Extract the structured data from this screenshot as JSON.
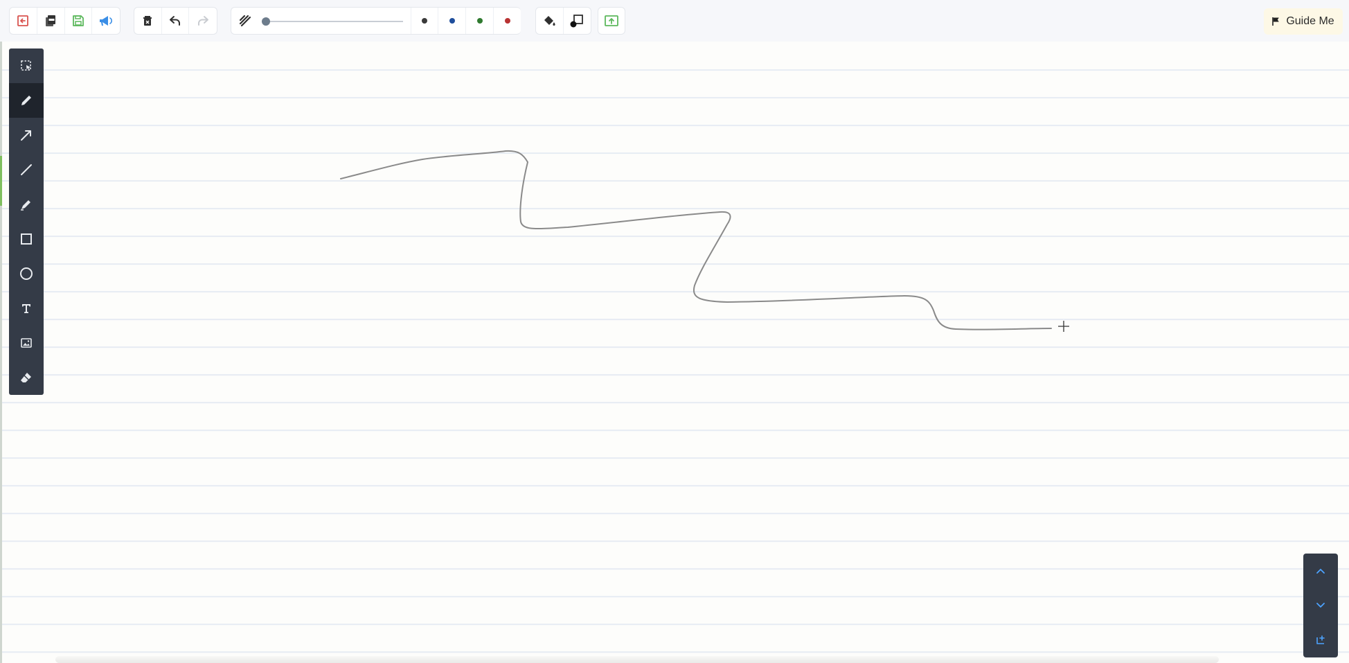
{
  "toolbar": {
    "file_group": [
      {
        "icon": "exit-icon",
        "color": "#d9534f"
      },
      {
        "icon": "pdf-icon",
        "color": "#444444"
      },
      {
        "icon": "save-icon",
        "color": "#5cb85c"
      },
      {
        "icon": "announcement-icon",
        "color": "#3a8ee6"
      }
    ],
    "edit_group": [
      {
        "icon": "clear-page-icon"
      },
      {
        "icon": "undo-icon"
      },
      {
        "icon": "redo-icon",
        "disabled": true
      }
    ],
    "stroke_width": {
      "icon": "stroke-width-icon",
      "value": 0.0
    },
    "pen_colors": [
      "#3a3a3a",
      "#1f4e9c",
      "#2f7a2f",
      "#b83232"
    ],
    "fill_group": [
      {
        "icon": "fill-bucket-icon"
      },
      {
        "icon": "shape-fill-icon"
      }
    ],
    "upload": {
      "icon": "upload-icon",
      "color": "#5cb85c"
    },
    "guide_label": "Guide Me",
    "guide_icon": "flag-icon"
  },
  "tools": [
    {
      "name": "select-tool",
      "icon": "selection-icon",
      "active": false
    },
    {
      "name": "pen-tool",
      "icon": "pen-icon",
      "active": true
    },
    {
      "name": "arrow-tool",
      "icon": "arrow-icon",
      "active": false
    },
    {
      "name": "line-tool",
      "icon": "line-icon",
      "active": false
    },
    {
      "name": "highlighter-tool",
      "icon": "highlighter-icon",
      "active": false
    },
    {
      "name": "rectangle-tool",
      "icon": "rectangle-icon",
      "active": false
    },
    {
      "name": "circle-tool",
      "icon": "circle-icon",
      "active": false
    },
    {
      "name": "text-tool",
      "icon": "text-icon",
      "active": false
    },
    {
      "name": "image-tool",
      "icon": "image-icon",
      "active": false
    },
    {
      "name": "eraser-tool",
      "icon": "eraser-icon",
      "active": false
    }
  ],
  "page_nav": [
    {
      "icon": "chevron-up-icon"
    },
    {
      "icon": "chevron-down-icon"
    },
    {
      "icon": "add-page-icon"
    }
  ],
  "canvas": {
    "stroke_color": "#8a8a8a",
    "cursor_icon": "crosshair-icon"
  }
}
